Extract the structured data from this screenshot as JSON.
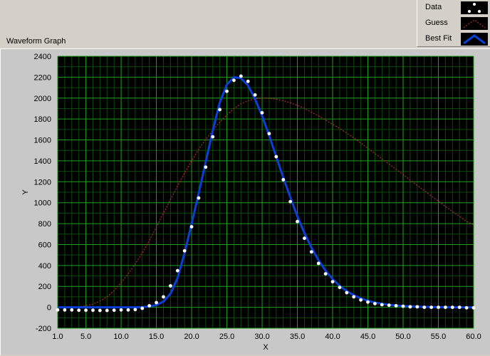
{
  "graph": {
    "label": "Waveform Graph"
  },
  "legend": {
    "items": [
      {
        "label": "Data",
        "style": "points",
        "color": "#ffffff"
      },
      {
        "label": "Guess",
        "style": "dashed-line",
        "color": "#cc3333"
      },
      {
        "label": "Best Fit",
        "style": "solid-line",
        "color": "#0a3fd8"
      }
    ]
  },
  "colors": {
    "plot_background": "#000000",
    "grid_major": "#1ea01e",
    "grid_minor": "#0c4a0c",
    "panel": "#d4d0c8"
  },
  "chart_data": {
    "type": "line",
    "title": "",
    "xlabel": "X",
    "ylabel": "Y",
    "xlim": [
      1.0,
      60.0
    ],
    "ylim": [
      -200,
      2400
    ],
    "xticks": [
      "1.0",
      "5.0",
      "10.0",
      "15.0",
      "20.0",
      "25.0",
      "30.0",
      "35.0",
      "40.0",
      "45.0",
      "50.0",
      "55.0",
      "60.0"
    ],
    "yticks": [
      "-200",
      "0",
      "200",
      "400",
      "600",
      "800",
      "1000",
      "1200",
      "1400",
      "1600",
      "1800",
      "2000",
      "2200",
      "2400"
    ],
    "grid": true,
    "legend_position": "top-right",
    "series": [
      {
        "name": "Data",
        "style": "points",
        "x": [
          1,
          2,
          3,
          4,
          5,
          6,
          7,
          8,
          9,
          10,
          11,
          12,
          13,
          14,
          15,
          16,
          17,
          18,
          19,
          20,
          21,
          22,
          23,
          24,
          25,
          26,
          27,
          28,
          29,
          30,
          31,
          32,
          33,
          34,
          35,
          36,
          37,
          38,
          39,
          40,
          41,
          42,
          43,
          44,
          45,
          46,
          47,
          48,
          49,
          50,
          51,
          52,
          53,
          54,
          55,
          56,
          57,
          58,
          59,
          60
        ],
        "y": [
          -25,
          -25,
          -25,
          -28,
          -28,
          -28,
          -30,
          -30,
          -28,
          -25,
          -25,
          -22,
          -10,
          15,
          45,
          100,
          205,
          350,
          540,
          770,
          1045,
          1340,
          1630,
          1890,
          2065,
          2170,
          2210,
          2160,
          2030,
          1860,
          1660,
          1440,
          1220,
          1010,
          820,
          660,
          530,
          420,
          320,
          245,
          190,
          140,
          100,
          70,
          50,
          35,
          25,
          20,
          15,
          10,
          5,
          5,
          0,
          0,
          0,
          0,
          0,
          0,
          -5,
          -5
        ]
      },
      {
        "name": "Guess",
        "style": "dashed",
        "x": [
          1,
          2,
          3,
          4,
          5,
          6,
          7,
          8,
          9,
          10,
          11,
          12,
          13,
          14,
          15,
          16,
          17,
          18,
          19,
          20,
          21,
          22,
          23,
          24,
          25,
          26,
          27,
          28,
          29,
          30,
          31,
          32,
          33,
          34,
          35,
          36,
          37,
          38,
          39,
          40,
          41,
          42,
          43,
          44,
          45,
          46,
          47,
          48,
          49,
          50,
          51,
          52,
          53,
          54,
          55,
          56,
          57,
          58,
          59,
          60
        ],
        "y": [
          0,
          0,
          2,
          5,
          15,
          30,
          60,
          100,
          160,
          235,
          320,
          415,
          520,
          640,
          765,
          900,
          1030,
          1160,
          1285,
          1400,
          1510,
          1605,
          1690,
          1770,
          1840,
          1900,
          1945,
          1975,
          1992,
          2000,
          1998,
          1990,
          1975,
          1955,
          1930,
          1900,
          1865,
          1830,
          1790,
          1750,
          1710,
          1665,
          1620,
          1570,
          1520,
          1470,
          1420,
          1370,
          1320,
          1270,
          1215,
          1165,
          1115,
          1065,
          1015,
          965,
          915,
          870,
          820,
          790
        ]
      },
      {
        "name": "Best Fit",
        "style": "solid",
        "x": [
          1,
          2,
          3,
          4,
          5,
          6,
          7,
          8,
          9,
          10,
          11,
          12,
          13,
          14,
          15,
          16,
          17,
          18,
          19,
          20,
          21,
          22,
          23,
          24,
          25,
          26,
          27,
          28,
          29,
          30,
          31,
          32,
          33,
          34,
          35,
          36,
          37,
          38,
          39,
          40,
          41,
          42,
          43,
          44,
          45,
          46,
          47,
          48,
          49,
          50,
          51,
          52,
          53,
          54,
          55,
          56,
          57,
          58,
          59,
          60
        ],
        "y": [
          0,
          0,
          0,
          0,
          0,
          0,
          0,
          0,
          0,
          0,
          0,
          0,
          2,
          8,
          22,
          55,
          130,
          280,
          520,
          800,
          1090,
          1390,
          1690,
          1960,
          2130,
          2200,
          2190,
          2120,
          1990,
          1830,
          1640,
          1440,
          1240,
          1050,
          870,
          710,
          570,
          450,
          350,
          270,
          205,
          155,
          115,
          85,
          62,
          45,
          33,
          24,
          17,
          12,
          9,
          6,
          4,
          3,
          2,
          1,
          1,
          0,
          0,
          0
        ]
      }
    ]
  }
}
